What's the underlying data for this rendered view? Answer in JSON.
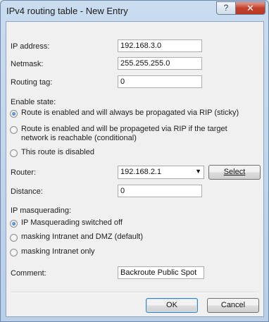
{
  "window": {
    "title": "IPv4 routing table - New Entry",
    "help_label": "?",
    "close_label": "✕"
  },
  "fields": {
    "ip_address": {
      "label": "IP address:",
      "value": "192.168.3.0"
    },
    "netmask": {
      "label": "Netmask:",
      "value": "255.255.255.0"
    },
    "routing_tag": {
      "label": "Routing tag:",
      "value": "0"
    }
  },
  "enable_state": {
    "label": "Enable state:",
    "options": [
      "Route is enabled and will always be propagated via RIP (sticky)",
      "Route is enabled and will be propageted via RIP if the target",
      "network is reachable (conditional)",
      "This route is disabled"
    ],
    "selected_index": 0
  },
  "router": {
    "label": "Router:",
    "value": "192.168.2.1",
    "select_label": "Select"
  },
  "distance": {
    "label": "Distance:",
    "value": "0"
  },
  "ip_masquerading": {
    "label": "IP masquerading:",
    "options": [
      "IP Masquerading switched off",
      "masking Intranet and DMZ (default)",
      "masking Intranet only"
    ],
    "selected_index": 0
  },
  "comment": {
    "label": "Comment:",
    "value": "Backroute Public Spot"
  },
  "buttons": {
    "ok": "OK",
    "cancel": "Cancel"
  },
  "colors": {
    "titlebar": "#c9dcf0",
    "close_button": "#c4412c",
    "client_bg": "#f0f0f0",
    "radio_dot": "#1d5fa8"
  }
}
